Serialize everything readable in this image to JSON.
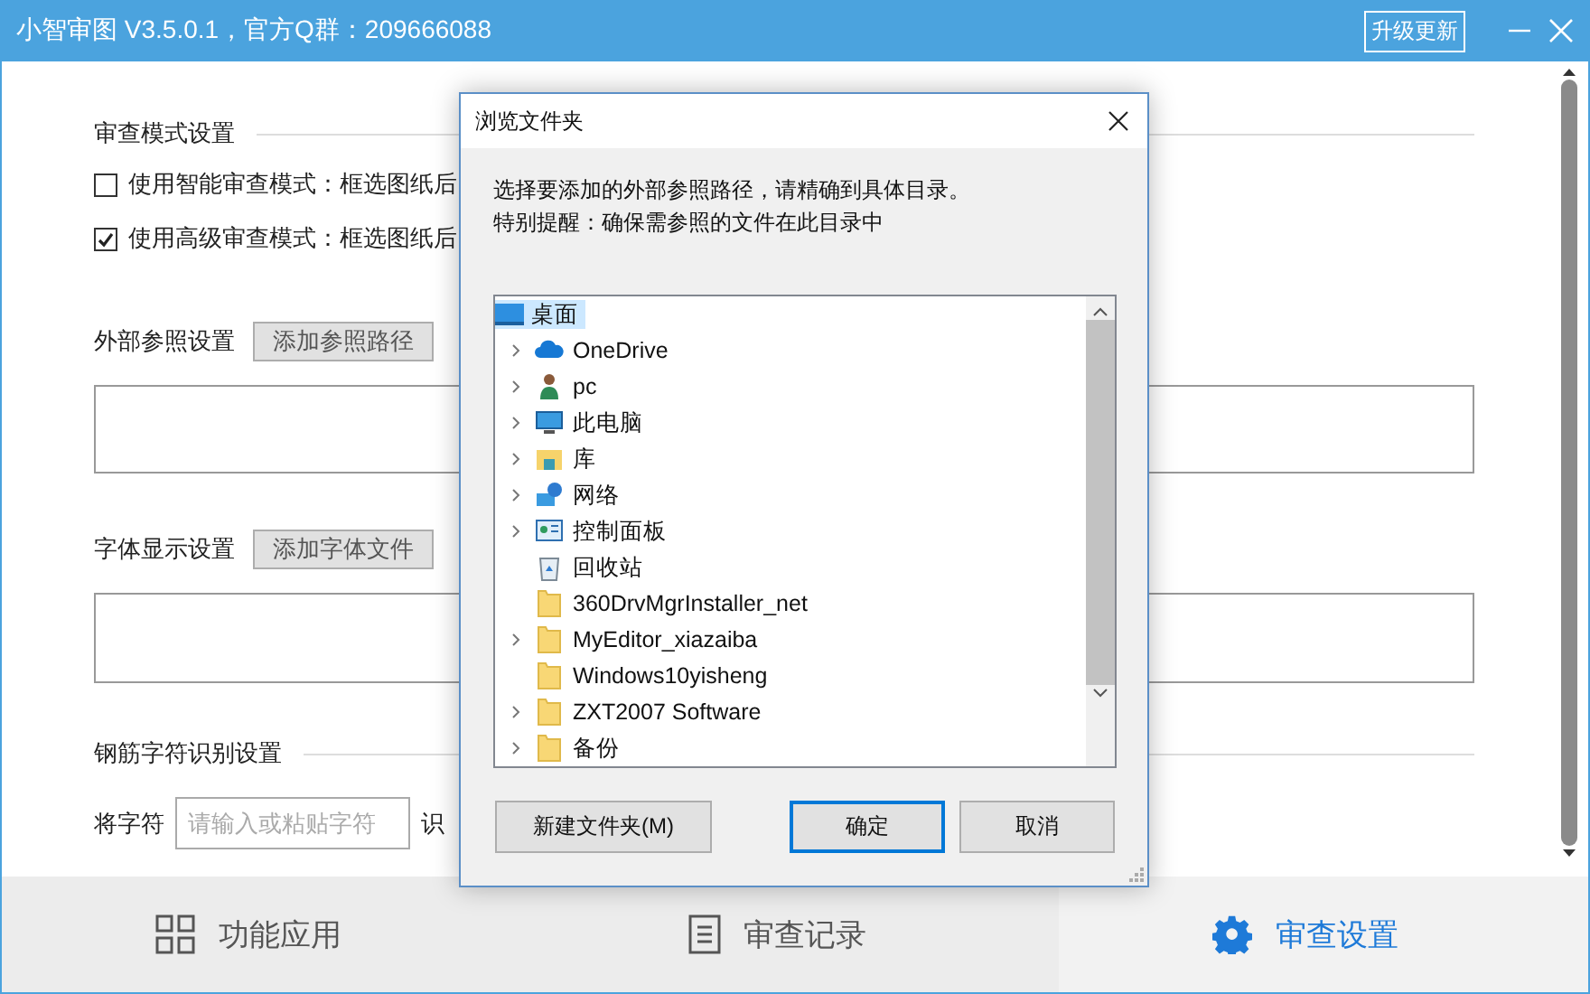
{
  "window": {
    "title": "小智审图 V3.5.0.1，官方Q群：209666088",
    "upgrade_button": "升级更新"
  },
  "review_mode": {
    "heading": "审查模式设置",
    "options": [
      {
        "label": "使用智能审查模式：框选图纸后",
        "checked": false
      },
      {
        "label": "使用高级审查模式：框选图纸后",
        "checked": true
      }
    ]
  },
  "xref": {
    "heading": "外部参照设置",
    "button": "添加参照路径"
  },
  "font": {
    "heading": "字体显示设置",
    "button": "添加字体文件"
  },
  "rebar": {
    "heading": "钢筋字符识别设置",
    "label": "将字符",
    "placeholder": "请输入或粘贴字符",
    "trailing_label": "识"
  },
  "bottom_nav": [
    {
      "label": "功能应用",
      "kind": "grid",
      "selected": false
    },
    {
      "label": "审查记录",
      "kind": "document",
      "selected": false
    },
    {
      "label": "审查设置",
      "kind": "gear",
      "selected": true
    }
  ],
  "dialog": {
    "title": "浏览文件夹",
    "instructions": [
      "选择要添加的外部参照路径，请精确到具体目录。",
      "特别提醒：确保需参照的文件在此目录中"
    ],
    "tree": [
      {
        "label": "桌面",
        "kind": "desktop",
        "selected": true,
        "children": [
          {
            "label": "OneDrive",
            "kind": "cloud",
            "selected": false,
            "expandable": true
          },
          {
            "label": "pc",
            "kind": "user",
            "selected": false,
            "expandable": true
          },
          {
            "label": "此电脑",
            "kind": "computer",
            "selected": false,
            "expandable": true
          },
          {
            "label": "库",
            "kind": "library",
            "selected": false,
            "expandable": true
          },
          {
            "label": "网络",
            "kind": "network",
            "selected": false,
            "expandable": true
          },
          {
            "label": "控制面板",
            "kind": "control-panel",
            "selected": false,
            "expandable": true
          },
          {
            "label": "回收站",
            "kind": "recycle-bin",
            "selected": false,
            "expandable": false
          },
          {
            "label": "360DrvMgrInstaller_net",
            "kind": "folder",
            "selected": false,
            "expandable": false
          },
          {
            "label": "MyEditor_xiazaiba",
            "kind": "folder",
            "selected": false,
            "expandable": true
          },
          {
            "label": "Windows10yisheng",
            "kind": "folder",
            "selected": false,
            "expandable": false
          },
          {
            "label": "ZXT2007 Software",
            "kind": "folder",
            "selected": false,
            "expandable": true
          },
          {
            "label": "备份",
            "kind": "folder",
            "selected": false,
            "expandable": true
          }
        ]
      }
    ],
    "buttons": [
      {
        "label": "新建文件夹(M)",
        "default": false
      },
      {
        "label": "确定",
        "default": true
      },
      {
        "label": "取消",
        "default": false
      }
    ]
  }
}
